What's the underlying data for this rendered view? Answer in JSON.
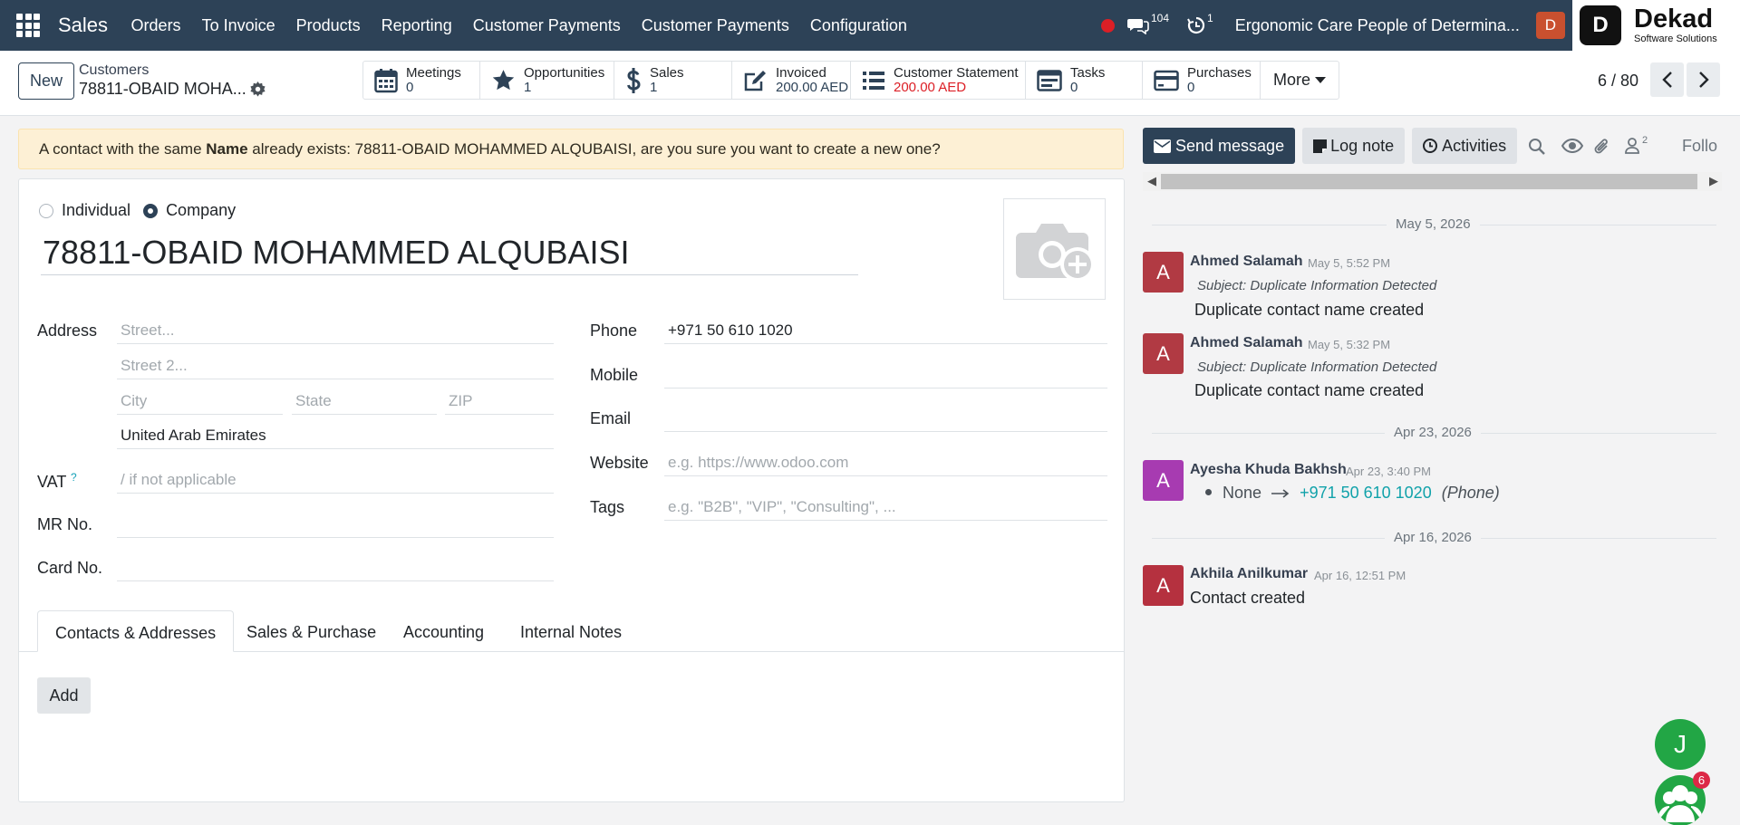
{
  "navbar": {
    "app_name": "Sales",
    "menu": [
      "Orders",
      "To Invoice",
      "Products",
      "Reporting",
      "Customer Payments",
      "Customer Payments",
      "Configuration"
    ],
    "messages_count": "104",
    "activities_count": "1",
    "company": "Ergonomic Care People of Determina...",
    "user_initial": "D",
    "logo_title": "Dekad",
    "logo_subtitle": "Software Solutions"
  },
  "control_panel": {
    "new_label": "New",
    "breadcrumb_parent": "Customers",
    "breadcrumb_current": "78811-OBAID MOHA...",
    "stats": [
      {
        "icon": "calendar-icon",
        "label": "Meetings",
        "value": "0"
      },
      {
        "icon": "star-icon",
        "label": "Opportunities",
        "value": "1"
      },
      {
        "icon": "dollar-icon",
        "label": "Sales",
        "value": "1"
      },
      {
        "icon": "invoice-edit-icon",
        "label": "Invoiced",
        "value": "200.00 AED"
      },
      {
        "icon": "list-icon",
        "label": "Customer Statement",
        "value": "200.00 AED"
      },
      {
        "icon": "tasks-icon",
        "label": "Tasks",
        "value": "0"
      },
      {
        "icon": "credit-card-icon",
        "label": "Purchases",
        "value": "0"
      }
    ],
    "more_label": "More",
    "pager": "6 / 80"
  },
  "warning": {
    "prefix": "A contact with the same ",
    "bold": "Name",
    "suffix": " already exists: 78811-OBAID MOHAMMED ALQUBAISI, are you sure you want to create a new one?"
  },
  "form": {
    "type_individual": "Individual",
    "type_company": "Company",
    "selected_type": "Company",
    "name": "78811-OBAID MOHAMMED ALQUBAISI",
    "address_label": "Address",
    "street_placeholder": "Street...",
    "street2_placeholder": "Street 2...",
    "city_placeholder": "City",
    "state_placeholder": "State",
    "zip_placeholder": "ZIP",
    "country": "United Arab Emirates",
    "vat_label": "VAT",
    "vat_help": "?",
    "vat_placeholder": "/ if not applicable",
    "mr_label": "MR No.",
    "card_label": "Card No.",
    "phone_label": "Phone",
    "phone": "+971 50 610 1020",
    "mobile_label": "Mobile",
    "email_label": "Email",
    "website_label": "Website",
    "website_placeholder": "e.g. https://www.odoo.com",
    "tags_label": "Tags",
    "tags_placeholder": "e.g. \"B2B\", \"VIP\", \"Consulting\", ...",
    "tabs": [
      "Contacts & Addresses",
      "Sales & Purchase",
      "Accounting",
      "Internal Notes"
    ],
    "add_label": "Add"
  },
  "chatter": {
    "send_message": "Send message",
    "log_note": "Log note",
    "activities": "Activities",
    "followers_count": "2",
    "follow_label": "Follo",
    "groups": [
      {
        "date": "May 5, 2026"
      },
      {
        "date": "Apr 23, 2026"
      },
      {
        "date": "Apr 16, 2026"
      }
    ],
    "messages": [
      {
        "initial": "A",
        "author": "Ahmed Salamah",
        "date": "May 5, 5:52 PM",
        "subject": "Subject: Duplicate Information Detected",
        "body": "Duplicate contact name created",
        "color": "#b13a43"
      },
      {
        "initial": "A",
        "author": "Ahmed Salamah",
        "date": "May 5, 5:32 PM",
        "subject": "Subject: Duplicate Information Detected",
        "body": "Duplicate contact name created",
        "color": "#b13a43"
      },
      {
        "initial": "A",
        "author": "Ayesha Khuda Bakhsh",
        "date": "Apr 23, 3:40 PM",
        "track_old": "None",
        "track_new": "+971 50 610 1020",
        "track_field": "(Phone)",
        "color": "#a73bb1"
      },
      {
        "initial": "A",
        "author": "Akhila Anilkumar",
        "date": "Apr 16, 12:51 PM",
        "body": "Contact created",
        "color": "#b5313f"
      }
    ]
  },
  "floating": {
    "j_initial": "J",
    "group_badge": "6"
  }
}
